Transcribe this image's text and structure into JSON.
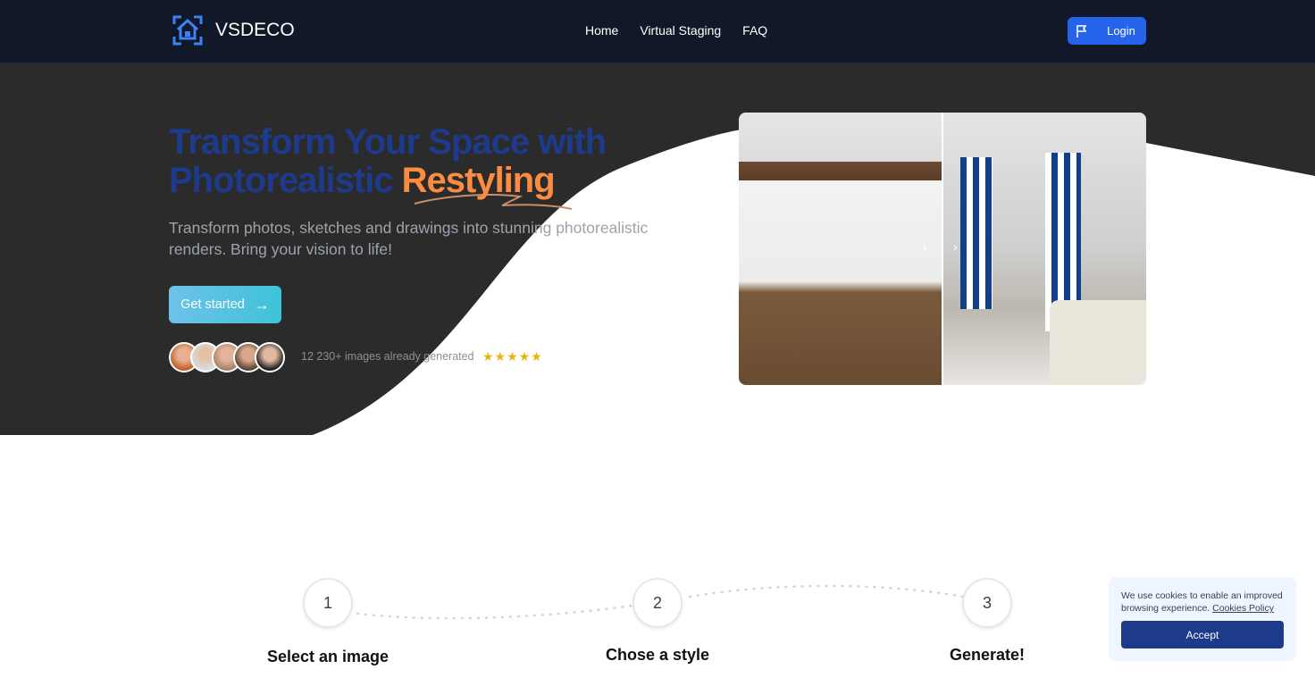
{
  "header": {
    "brand": "VSDECO",
    "nav": [
      "Home",
      "Virtual Staging",
      "FAQ"
    ],
    "login": "Login"
  },
  "hero": {
    "title_main": "Transform Your Space with Photorealistic ",
    "title_accent": "Restyling",
    "subtitle": "Transform photos, sketches and drawings into stunning photorealistic renders. Bring your vision to life!",
    "cta": "Get started",
    "count_text": "12 230+ images already generated",
    "rating": 5,
    "stars": "★★★★★"
  },
  "steps": [
    {
      "number": "1",
      "title": "Select an image"
    },
    {
      "number": "2",
      "title": "Chose a style"
    },
    {
      "number": "3",
      "title": "Generate!"
    }
  ],
  "cookie": {
    "text": "We use cookies to enable an improved browsing experience.",
    "link": "Cookies Policy",
    "accept": "Accept"
  },
  "colors": {
    "header": "#111827",
    "hero": "#2b2b2b",
    "primary": "#2563eb",
    "title": "#1e3a8a",
    "accent": "#fb8c42"
  }
}
